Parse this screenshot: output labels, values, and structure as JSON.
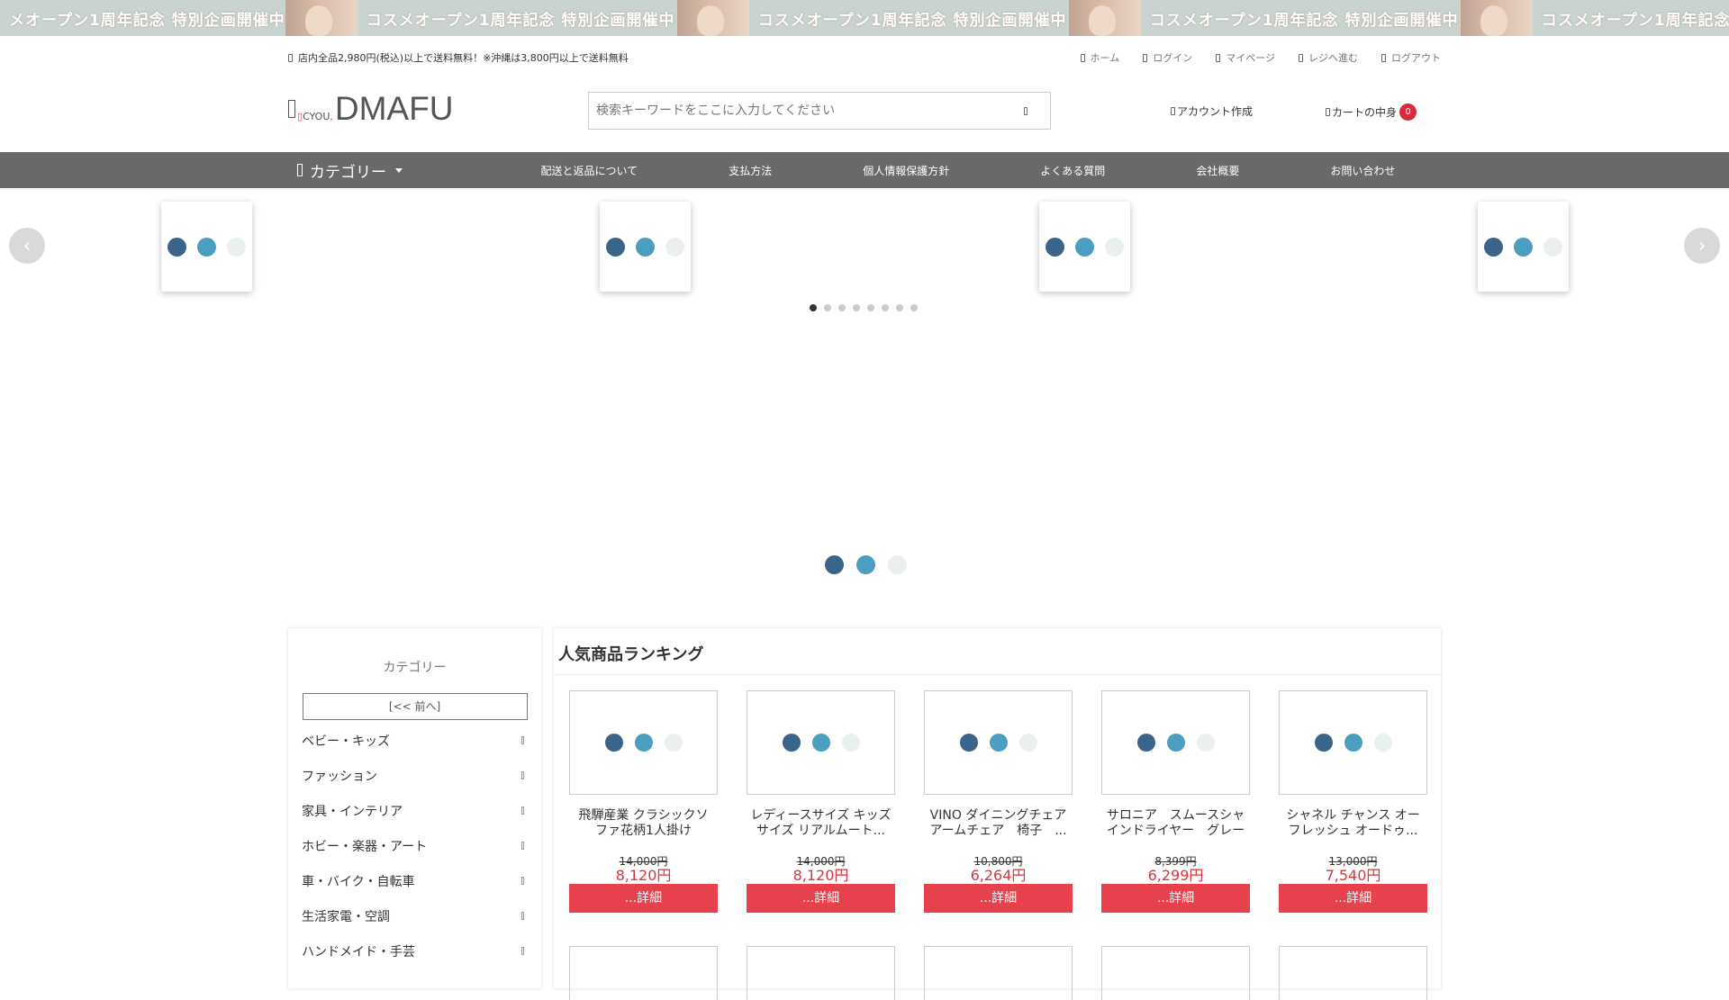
{
  "promo": {
    "text": "コスメオープン1周年記念 特別企画開催中",
    "tiles": [
      "メオープン1周年記念 特別企画開催中",
      "コスメオープン1周年記念 特別企画開催中",
      "コスメオープン1周年記念 特別企画開催中",
      "コスメオープン1周年記念 特別企画開催中",
      "コスメオープン1周年記念 特別企画開催中"
    ]
  },
  "topbar": {
    "notice": "店内全品2,980円(税込)以上で送料無料！※沖縄は3,800円以上で送料無料",
    "links": [
      "ホーム",
      "ログイン",
      "マイページ",
      "レジへ進む",
      "ログアウト"
    ]
  },
  "header": {
    "logo_small": "CYOU",
    "logo_mark": ",",
    "logo_big": "DMAFU",
    "search_placeholder": "検索キーワードをここに入力してください",
    "account_label": "アカウント作成",
    "cart_label": "カートの中身",
    "cart_count": "0"
  },
  "nav": {
    "category_label": "カテゴリー",
    "items": [
      "配送と返品について",
      "支払方法",
      "個人情報保護方針",
      "よくある質問",
      "会社概要",
      "お問い合わせ"
    ]
  },
  "slider": {
    "page_count": 8,
    "active_page": 1,
    "prev_label": "‹",
    "next_label": "›"
  },
  "sidebar": {
    "title": "カテゴリー",
    "prev_button": "[<< 前へ]",
    "categories": [
      "ベビー・キッズ",
      "ファッション",
      "家具・インテリア",
      "ホビー・楽器・アート",
      "車・バイク・自転車",
      "生活家電・空調",
      "ハンドメイド・手芸"
    ]
  },
  "ranking": {
    "title": "人気商品ランキング",
    "detail_label": "...詳細",
    "products": [
      {
        "name": "飛騨産業 クラシックソファ花柄1人掛け",
        "orig": "14,000円",
        "sale": "8,120円"
      },
      {
        "name": "レディースサイズ キッズサイズ リアルムート...",
        "orig": "14,000円",
        "sale": "8,120円"
      },
      {
        "name": "VINO ダイニングチェア アームチェア　椅子　...",
        "orig": "10,800円",
        "sale": "6,264円"
      },
      {
        "name": "サロニア　スムースシャインドライヤー　グレー",
        "orig": "8,399円",
        "sale": "6,299円"
      },
      {
        "name": "シャネル チャンス オーフレッシュ オードゥ...",
        "orig": "13,000円",
        "sale": "7,540円"
      }
    ]
  },
  "colors": {
    "nav_bg": "#696969",
    "accent_red": "#e8414e",
    "price_red": "#d7363c",
    "loader_dark": "#3a6589",
    "loader_mid": "#4b9ec0",
    "loader_light": "#eaf0ef"
  }
}
